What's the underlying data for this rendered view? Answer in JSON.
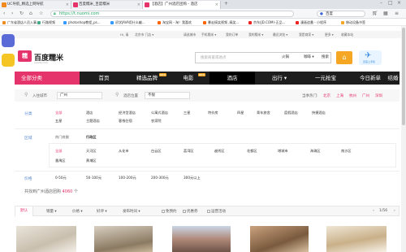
{
  "browser": {
    "tabs": [
      {
        "label": "UC导航_精选上网导航",
        "color": "#f08b1f"
      },
      {
        "label": "百度糯米_百度糯米",
        "color": "#e5336b"
      },
      {
        "label": "【酒店】广州酒店团购 - 酒店",
        "color": "#e5336b"
      }
    ],
    "url": "https://t.nuomi.com",
    "search_engine": "百度",
    "bookmarks": [
      "广东省酒店人员入事...",
      "行路视频",
      "photoshop教程_ps...",
      "初学JAVA用什么编...",
      "淘宝网 - 淘！我喜欢",
      "暴走搞笑视频 ,搞笑...",
      "京东(JD.COM)-正品...",
      "漫画追番 - 小程序",
      "移动设备书签"
    ]
  },
  "site_topnav": [
    "Hi, 请",
    "北京市 门店 ▾",
    "请选城市",
    "手机糯米 ▾",
    "我的订单",
    "我的糯米 ▾",
    "最近浏览 ▾",
    "我是商家 ▾",
    "更多 ▾",
    "收藏本站"
  ],
  "header": {
    "logo_mark": "糯",
    "logo_text": "百度糯米",
    "logo_sub": "nuomi.com",
    "search_placeholder": "搜索商家或地点",
    "search_buttons": [
      "火锅",
      "咖啡 ▾",
      "搜索"
    ],
    "app_label": "百度上手机"
  },
  "mainnav": {
    "all_categories": "全部分类",
    "items": [
      {
        "label": "首页",
        "badge": ""
      },
      {
        "label": "精选品牌",
        "badge": "NEW"
      },
      {
        "label": "电影",
        "badge": "NEW"
      },
      {
        "label": "酒店",
        "badge": ""
      },
      {
        "label": "出行 ▾",
        "badge": ""
      },
      {
        "label": "一元抢宝",
        "badge": ""
      },
      {
        "label": "今日新单",
        "badge": ""
      },
      {
        "label": "结婚",
        "badge": ""
      }
    ]
  },
  "cityrow": {
    "city_label": "入住城市",
    "city_value": "广州",
    "pos_label": "酒店位置",
    "pos_value": "不限",
    "right_label": "当季热门:",
    "hot_cities": [
      "北京",
      "上海",
      "杭州",
      "广州",
      "深圳"
    ]
  },
  "filters": {
    "category": {
      "head": "分类",
      "row1": [
        "全部",
        "酒店",
        "经济型酒店",
        "公寓式酒店",
        "三星",
        "特价房",
        "四星",
        "青年旅舍",
        "度假酒店",
        "快捷酒店"
      ],
      "row2": [
        "五星",
        "主题酒店",
        "客栈住宿",
        "农家院"
      ]
    },
    "area": {
      "head": "区域",
      "tabs": [
        "热门商圈",
        "行政区"
      ],
      "row1": [
        "全部",
        "天河区",
        "从化市",
        "白云区",
        "荔湾区",
        "越秀区",
        "花都区",
        "增城市",
        "海珠区",
        "南沙区"
      ],
      "row2": [
        "番禺区",
        "黄埔区"
      ]
    },
    "price": {
      "head": "价格",
      "row": [
        "0-50元",
        "50-100元",
        "100-200元",
        "200-300元",
        "300元以上"
      ]
    }
  },
  "result_count": {
    "prefix": "共找到广州酒店团购",
    "count": "4060",
    "suffix": "个"
  },
  "sortbar": {
    "items": [
      "默认",
      "销量 ▾",
      "价格 ▾",
      "好评 ▾",
      "发布时间 ▾"
    ],
    "checkboxes": [
      "免预约",
      "优惠券",
      "运营活动"
    ],
    "page": "1/56"
  },
  "colors": {
    "brand": "#e5336b",
    "nav_bg": "#1e1e1e",
    "accent": "#f5a623"
  }
}
